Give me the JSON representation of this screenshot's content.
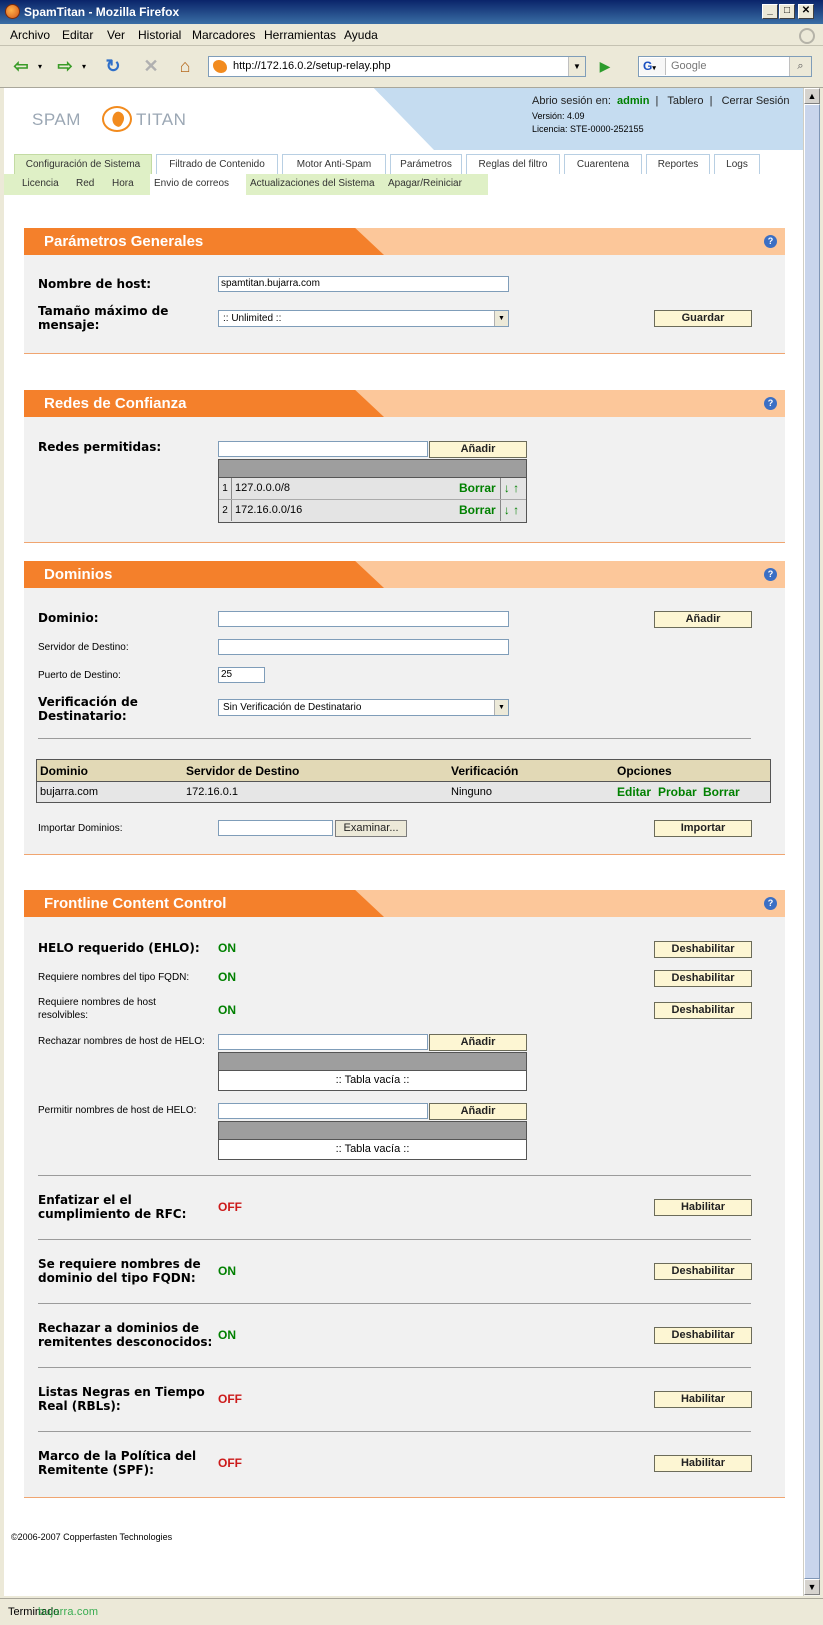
{
  "window": {
    "title": "SpamTitan - Mozilla Firefox",
    "controls": {
      "min": "_",
      "max": "□",
      "close": "✕"
    }
  },
  "menu": [
    "Archivo",
    "Editar",
    "Ver",
    "Historial",
    "Marcadores",
    "Herramientas",
    "Ayuda"
  ],
  "toolbar": {
    "url": "http://172.16.0.2/setup-relay.php",
    "search_placeholder": "Google",
    "search_engine_badge": "G"
  },
  "status": {
    "text": "Terminado",
    "watermark": "bujarra.com"
  },
  "header": {
    "logo_left": "SPAM",
    "logo_right": "TITAN",
    "session_prefix": "Abrio sesión en:",
    "user": "admin",
    "dashboard_link": "Tablero",
    "logout_link": "Cerrar Sesión",
    "version": "Versión: 4.09",
    "license": "Licencia: STE-0000-252155"
  },
  "tabs": [
    "Configuración de Sistema",
    "Filtrado de Contenido",
    "Motor Anti-Spam",
    "Parámetros",
    "Reglas del filtro",
    "Cuarentena",
    "Reportes",
    "Logs"
  ],
  "subtabs": [
    "Licencia",
    "Red",
    "Hora",
    "Envio de correos",
    "Actualizaciones del Sistema",
    "Apagar/Reiniciar"
  ],
  "help_icon": "?",
  "general": {
    "title": "Parámetros Generales",
    "host_label": "Nombre de host:",
    "host_value": "spamtitan.bujarra.com",
    "max_size_label_1": "Tamaño máximo de",
    "max_size_label_2": "mensaje:",
    "max_size_value": ":: Unlimited ::",
    "save_button": "Guardar"
  },
  "trusted": {
    "title": "Redes de Confianza",
    "label": "Redes permitidas:",
    "input_value": "",
    "add_button": "Añadir",
    "rows": [
      {
        "index": "1",
        "network": "127.0.0.0/8",
        "delete": "Borrar",
        "move": "↓ ↑"
      },
      {
        "index": "2",
        "network": "172.16.0.0/16",
        "delete": "Borrar",
        "move": "↓ ↑"
      }
    ]
  },
  "domains": {
    "title": "Dominios",
    "domain_label": "Dominio:",
    "dest_server_label": "Servidor de Destino:",
    "dest_port_label": "Puerto de Destino:",
    "dest_port_value": "25",
    "verify_label_1": "Verificación de",
    "verify_label_2": "Destinatario:",
    "verify_value": "Sin Verificación de Destinatario",
    "add_button": "Añadir",
    "table_headers": [
      "Dominio",
      "Servidor de Destino",
      "Verificación",
      "Opciones"
    ],
    "table_row": {
      "domain": "bujarra.com",
      "server": "172.16.0.1",
      "verification": "Ninguno",
      "edit": "Editar",
      "test": "Probar",
      "delete": "Borrar"
    },
    "import_label": "Importar Dominios:",
    "browse_button": "Examinar...",
    "import_button": "Importar"
  },
  "frontline": {
    "title": "Frontline Content Control",
    "helo_label": "HELO requerido (EHLO):",
    "helo_state": "ON",
    "helo_button": "Deshabilitar",
    "fqdn_label": "Requiere nombres del tipo FQDN:",
    "fqdn_state": "ON",
    "fqdn_button": "Deshabilitar",
    "resolvable_label_1": "Requiere nombres de host",
    "resolvable_label_2": "resolvibles:",
    "resolvable_state": "ON",
    "resolvable_button": "Deshabilitar",
    "reject_helo_label": "Rechazar nombres de host de HELO:",
    "reject_add": "Añadir",
    "reject_empty": ":: Tabla vacía ::",
    "allow_helo_label": "Permitir nombres de host de HELO:",
    "allow_add": "Añadir",
    "allow_empty": ":: Tabla vacía ::",
    "rfc_label_1": "Enfatizar el el",
    "rfc_label_2": "cumplimiento de RFC:",
    "rfc_state": "OFF",
    "rfc_button": "Habilitar",
    "fqdn_domain_label_1": "Se requiere nombres de",
    "fqdn_domain_label_2": "dominio del tipo FQDN:",
    "fqdn_domain_state": "ON",
    "fqdn_domain_button": "Deshabilitar",
    "unknown_label_1": "Rechazar a dominios de",
    "unknown_label_2": "remitentes desconocidos:",
    "unknown_state": "ON",
    "unknown_button": "Deshabilitar",
    "rbl_label_1": "Listas Negras en Tiempo",
    "rbl_label_2": "Real (RBLs):",
    "rbl_state": "OFF",
    "rbl_button": "Habilitar",
    "spf_label_1": "Marco de la Política del",
    "spf_label_2": "Remitente (SPF):",
    "spf_state": "OFF",
    "spf_button": "Habilitar"
  },
  "footer": "©2006-2007 Copperfasten Technologies",
  "colors": {
    "accent_orange": "#f4802b",
    "on_green": "#008000",
    "off_red": "#cc1a1a",
    "tab_green": "#dff0c6"
  }
}
